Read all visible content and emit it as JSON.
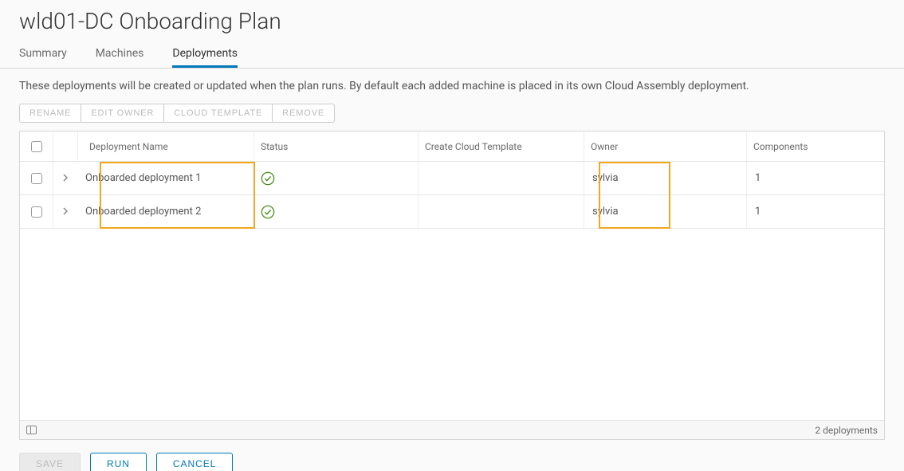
{
  "page_title": "wld01-DC Onboarding Plan",
  "tabs": [
    {
      "label": "Summary",
      "active": false
    },
    {
      "label": "Machines",
      "active": false
    },
    {
      "label": "Deployments",
      "active": true
    }
  ],
  "description": "These deployments will be created or updated when the plan runs. By default each added machine is placed in its own Cloud Assembly deployment.",
  "toolbar": {
    "rename": "RENAME",
    "edit_owner": "EDIT OWNER",
    "cloud_template": "CLOUD TEMPLATE",
    "remove": "REMOVE"
  },
  "columns": {
    "name": "Deployment Name",
    "status": "Status",
    "template": "Create Cloud Template",
    "owner": "Owner",
    "components": "Components"
  },
  "rows": [
    {
      "name": "Onboarded deployment 1",
      "status": "ok",
      "template": "",
      "owner": "sylvia",
      "components": "1"
    },
    {
      "name": "Onboarded deployment 2",
      "status": "ok",
      "template": "",
      "owner": "sylvia",
      "components": "1"
    }
  ],
  "footer_count": "2 deployments",
  "actions": {
    "save": "SAVE",
    "run": "RUN",
    "cancel": "CANCEL"
  }
}
